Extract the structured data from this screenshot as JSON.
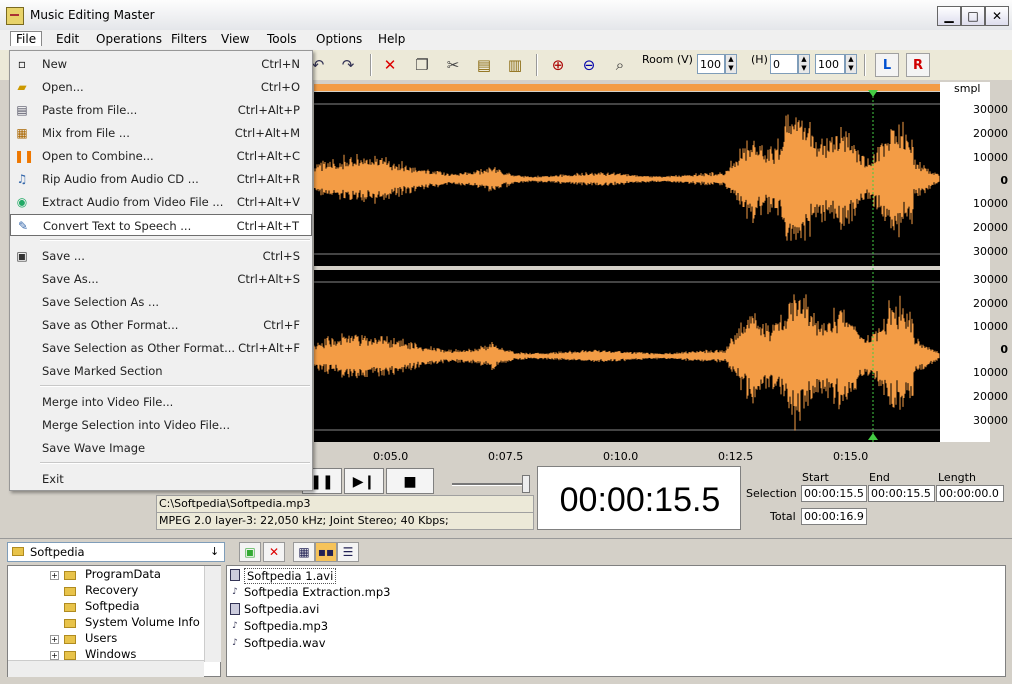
{
  "window": {
    "title": "Music Editing Master",
    "minimize": "▁",
    "maximize": "□",
    "close": "✕"
  },
  "menubar": [
    "File",
    "Edit",
    "Operations",
    "Filters",
    "View",
    "Tools",
    "Options",
    "Help"
  ],
  "file_menu": {
    "items": [
      {
        "label": "New",
        "shortcut": "Ctrl+N",
        "icon": "new-file-icon"
      },
      {
        "label": "Open...",
        "shortcut": "Ctrl+O",
        "icon": "open-folder-icon"
      },
      {
        "label": "Paste from File...",
        "shortcut": "Ctrl+Alt+P",
        "icon": "paste-file-icon"
      },
      {
        "label": "Mix from File ...",
        "shortcut": "Ctrl+Alt+M",
        "icon": "mix-icon"
      },
      {
        "label": "Open to Combine...",
        "shortcut": "Ctrl+Alt+C",
        "icon": "combine-icon"
      },
      {
        "label": "Rip Audio from Audio CD ...",
        "shortcut": "Ctrl+Alt+R",
        "icon": "cd-icon"
      },
      {
        "label": "Extract Audio from Video File ...",
        "shortcut": "Ctrl+Alt+V",
        "icon": "video-icon"
      },
      {
        "label": "Convert Text to Speech ...",
        "shortcut": "Ctrl+Alt+T",
        "icon": "pen-icon"
      },
      {
        "label": "Save ...",
        "shortcut": "Ctrl+S",
        "icon": "save-icon"
      },
      {
        "label": "Save As...",
        "shortcut": "Ctrl+Alt+S",
        "icon": ""
      },
      {
        "label": "Save Selection As ...",
        "shortcut": "",
        "icon": ""
      },
      {
        "label": "Save as Other Format...",
        "shortcut": "Ctrl+F",
        "icon": ""
      },
      {
        "label": "Save Selection as Other Format...",
        "shortcut": "Ctrl+Alt+F",
        "icon": ""
      },
      {
        "label": "Save Marked Section",
        "shortcut": "",
        "icon": ""
      },
      {
        "label": "Merge into Video File...",
        "shortcut": "",
        "icon": ""
      },
      {
        "label": "Merge Selection into Video File...",
        "shortcut": "",
        "icon": ""
      },
      {
        "label": "Save Wave Image",
        "shortcut": "",
        "icon": ""
      },
      {
        "label": "Exit",
        "shortcut": "",
        "icon": ""
      }
    ]
  },
  "toolbar": {
    "room_label": "Room (V)",
    "room_v": "100",
    "h_label": "(H)",
    "h_value": "0",
    "room_h": "100",
    "left_channel": "L",
    "right_channel": "R"
  },
  "scale": {
    "unit": "smpl",
    "top_labels": [
      "30000",
      "20000",
      "10000",
      "0",
      "10000",
      "20000",
      "30000"
    ],
    "bottom_labels": [
      "30000",
      "20000",
      "10000",
      "0",
      "10000",
      "20000",
      "30000"
    ]
  },
  "timeline": [
    "0:05.0",
    "0:07.5",
    "0:10.0",
    "0:12.5",
    "0:15.0"
  ],
  "status": {
    "file_path": "C:\\Softpedia\\Softpedia.mp3",
    "format": "MPEG 2.0 layer-3: 22,050 kHz; Joint Stereo; 40 Kbps;",
    "timecode": "00:00:15.5"
  },
  "selection": {
    "start_header": "Start",
    "end_header": "End",
    "length_header": "Length",
    "selection_label": "Selection",
    "total_label": "Total",
    "start": "00:00:15.5",
    "end": "00:00:15.5",
    "length": "00:00:00.0",
    "total": "00:00:16.9"
  },
  "browser": {
    "current_folder": "Softpedia",
    "tree": [
      "ProgramData",
      "Recovery",
      "Softpedia",
      "System Volume Info",
      "Users",
      "Windows"
    ],
    "files": [
      "Softpedia 1.avi",
      "Softpedia Extraction.mp3",
      "Softpedia.avi",
      "Softpedia.mp3",
      "Softpedia.wav"
    ]
  },
  "colors": {
    "waveform": "#f39c45",
    "wave_bg": "#000000",
    "accent_blue": "#0050d0",
    "accent_red": "#d00000"
  }
}
